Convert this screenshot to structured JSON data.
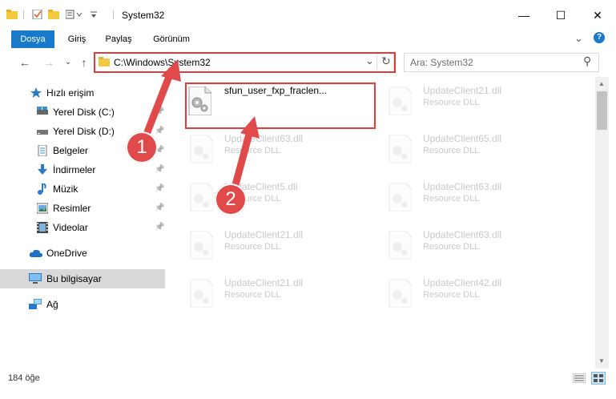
{
  "window": {
    "title": "System32",
    "minimize_glyph": "—",
    "maximize_glyph": "☐",
    "close_glyph": "✕"
  },
  "ribbon": {
    "tabs": [
      "Dosya",
      "Giriş",
      "Paylaş",
      "Görünüm"
    ],
    "collapse_glyph": "⌄",
    "help_glyph": "?"
  },
  "navigation": {
    "back_glyph": "←",
    "forward_glyph": "→",
    "recent_glyph": "⌄",
    "up_glyph": "↑"
  },
  "address": {
    "path": "C:\\Windows\\System32",
    "dropdown_glyph": "⌄",
    "refresh_glyph": "↻"
  },
  "search": {
    "placeholder": "Ara: System32",
    "icon_glyph": "⚲"
  },
  "sidebar": {
    "items": [
      {
        "label": "Hızlı erişim",
        "icon": "star-icon"
      },
      {
        "label": "Yerel Disk (C:)",
        "icon": "drive-icon"
      },
      {
        "label": "Yerel Disk (D:)",
        "icon": "drive-icon"
      },
      {
        "label": "Belgeler",
        "icon": "document-icon"
      },
      {
        "label": "İndirmeler",
        "icon": "download-icon"
      },
      {
        "label": "Müzik",
        "icon": "music-icon"
      },
      {
        "label": "Resimler",
        "icon": "picture-icon"
      },
      {
        "label": "Videolar",
        "icon": "video-icon"
      },
      {
        "label": "OneDrive",
        "icon": "cloud-icon"
      },
      {
        "label": "Bu bilgisayar",
        "icon": "computer-icon"
      },
      {
        "label": "Ağ",
        "icon": "network-icon"
      }
    ],
    "pin_glyph": "📌"
  },
  "files": {
    "highlighted": {
      "name": "sfun_user_fxp_fraclen..."
    },
    "items": [
      {
        "name": "UpdateClient21.dll",
        "type": "Resource DLL"
      },
      {
        "name": "UpdateClient63.dll",
        "type": "Resource DLL"
      },
      {
        "name": "UpdateClient65.dll",
        "type": "Resource DLL"
      },
      {
        "name": "UpdateClient5.dll",
        "type": "Resource DLL"
      },
      {
        "name": "UpdateClient63.dll",
        "type": "Resource DLL"
      },
      {
        "name": "UpdateClient21.dll",
        "type": "Resource DLL"
      },
      {
        "name": "UpdateClient63.dll",
        "type": "Resource DLL"
      },
      {
        "name": "UpdateClient21.dll",
        "type": "Resource DLL"
      },
      {
        "name": "UpdateClient42.dll",
        "type": "Resource DLL"
      }
    ]
  },
  "status": {
    "count_text": "184 öğe"
  },
  "callouts": {
    "first": "1",
    "second": "2"
  },
  "colors": {
    "file_tab": "#1979ca",
    "highlight": "#e03c3c",
    "callout": "#e04a4a"
  }
}
